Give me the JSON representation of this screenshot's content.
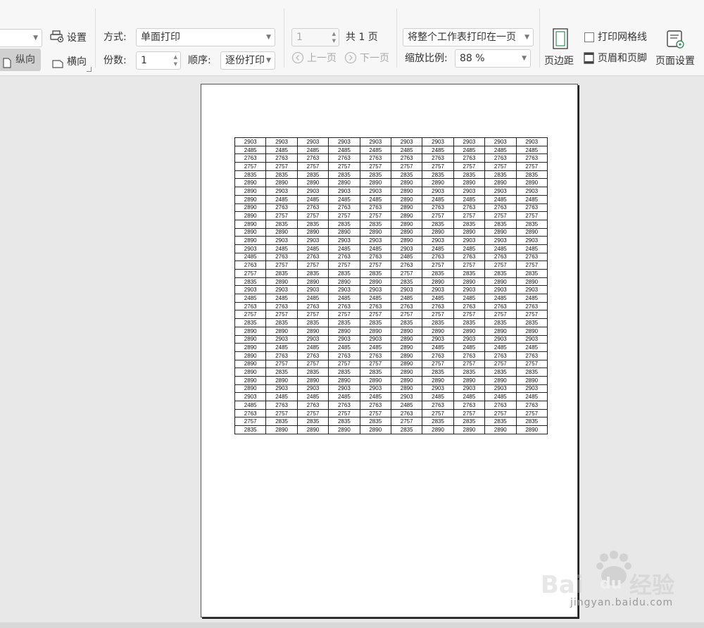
{
  "toolbar": {
    "settings_label": "设置",
    "portrait_label": "纵向",
    "landscape_label": "横向",
    "mode_label": "方式:",
    "mode_value": "单面打印",
    "copies_label": "份数:",
    "copies_value": "1",
    "order_label": "顺序:",
    "order_value": "逐份打印",
    "page_input": "1",
    "total_pages": "共 1 页",
    "prev_page": "上一页",
    "next_page": "下一页",
    "fit_value": "将整个工作表打印在一页",
    "zoom_label": "缩放比例:",
    "zoom_value": "88 %",
    "margins_label": "页边距",
    "gridlines_label": "打印网格线",
    "header_footer_label": "页眉和页脚",
    "page_setup_label": "页面设置"
  },
  "sheet": {
    "rows": [
      [
        "2903",
        "2903",
        "2903",
        "2903",
        "2903",
        "2903",
        "2903",
        "2903",
        "2903",
        "2903"
      ],
      [
        "2485",
        "2485",
        "2485",
        "2485",
        "2485",
        "2485",
        "2485",
        "2485",
        "2485",
        "2485"
      ],
      [
        "2763",
        "2763",
        "2763",
        "2763",
        "2763",
        "2763",
        "2763",
        "2763",
        "2763",
        "2763"
      ],
      [
        "2757",
        "2757",
        "2757",
        "2757",
        "2757",
        "2757",
        "2757",
        "2757",
        "2757",
        "2757"
      ],
      [
        "2835",
        "2835",
        "2835",
        "2835",
        "2835",
        "2835",
        "2835",
        "2835",
        "2835",
        "2835"
      ],
      [
        "2890",
        "2890",
        "2890",
        "2890",
        "2890",
        "2890",
        "2890",
        "2890",
        "2890",
        "2890"
      ],
      [
        "2890",
        "2903",
        "2903",
        "2903",
        "2903",
        "2890",
        "2903",
        "2903",
        "2903",
        "2903"
      ],
      [
        "2890",
        "2485",
        "2485",
        "2485",
        "2485",
        "2890",
        "2485",
        "2485",
        "2485",
        "2485"
      ],
      [
        "2890",
        "2763",
        "2763",
        "2763",
        "2763",
        "2890",
        "2763",
        "2763",
        "2763",
        "2763"
      ],
      [
        "2890",
        "2757",
        "2757",
        "2757",
        "2757",
        "2890",
        "2757",
        "2757",
        "2757",
        "2757"
      ],
      [
        "2890",
        "2835",
        "2835",
        "2835",
        "2835",
        "2890",
        "2835",
        "2835",
        "2835",
        "2835"
      ],
      [
        "2890",
        "2890",
        "2890",
        "2890",
        "2890",
        "2890",
        "2890",
        "2890",
        "2890",
        "2890"
      ],
      [
        "2890",
        "2903",
        "2903",
        "2903",
        "2903",
        "2890",
        "2903",
        "2903",
        "2903",
        "2903"
      ],
      [
        "2903",
        "2485",
        "2485",
        "2485",
        "2485",
        "2903",
        "2485",
        "2485",
        "2485",
        "2485"
      ],
      [
        "2485",
        "2763",
        "2763",
        "2763",
        "2763",
        "2485",
        "2763",
        "2763",
        "2763",
        "2763"
      ],
      [
        "2763",
        "2757",
        "2757",
        "2757",
        "2757",
        "2763",
        "2757",
        "2757",
        "2757",
        "2757"
      ],
      [
        "2757",
        "2835",
        "2835",
        "2835",
        "2835",
        "2757",
        "2835",
        "2835",
        "2835",
        "2835"
      ],
      [
        "2835",
        "2890",
        "2890",
        "2890",
        "2890",
        "2835",
        "2890",
        "2890",
        "2890",
        "2890"
      ],
      [
        "2903",
        "2903",
        "2903",
        "2903",
        "2903",
        "2903",
        "2903",
        "2903",
        "2903",
        "2903"
      ],
      [
        "2485",
        "2485",
        "2485",
        "2485",
        "2485",
        "2485",
        "2485",
        "2485",
        "2485",
        "2485"
      ],
      [
        "2763",
        "2763",
        "2763",
        "2763",
        "2763",
        "2763",
        "2763",
        "2763",
        "2763",
        "2763"
      ],
      [
        "2757",
        "2757",
        "2757",
        "2757",
        "2757",
        "2757",
        "2757",
        "2757",
        "2757",
        "2757"
      ],
      [
        "2835",
        "2835",
        "2835",
        "2835",
        "2835",
        "2835",
        "2835",
        "2835",
        "2835",
        "2835"
      ],
      [
        "2890",
        "2890",
        "2890",
        "2890",
        "2890",
        "2890",
        "2890",
        "2890",
        "2890",
        "2890"
      ],
      [
        "2890",
        "2903",
        "2903",
        "2903",
        "2903",
        "2890",
        "2903",
        "2903",
        "2903",
        "2903"
      ],
      [
        "2890",
        "2485",
        "2485",
        "2485",
        "2485",
        "2890",
        "2485",
        "2485",
        "2485",
        "2485"
      ],
      [
        "2890",
        "2763",
        "2763",
        "2763",
        "2763",
        "2890",
        "2763",
        "2763",
        "2763",
        "2763"
      ],
      [
        "2890",
        "2757",
        "2757",
        "2757",
        "2757",
        "2890",
        "2757",
        "2757",
        "2757",
        "2757"
      ],
      [
        "2890",
        "2835",
        "2835",
        "2835",
        "2835",
        "2890",
        "2835",
        "2835",
        "2835",
        "2835"
      ],
      [
        "2890",
        "2890",
        "2890",
        "2890",
        "2890",
        "2890",
        "2890",
        "2890",
        "2890",
        "2890"
      ],
      [
        "2890",
        "2903",
        "2903",
        "2903",
        "2903",
        "2890",
        "2903",
        "2903",
        "2903",
        "2903"
      ],
      [
        "2903",
        "2485",
        "2485",
        "2485",
        "2485",
        "2903",
        "2485",
        "2485",
        "2485",
        "2485"
      ],
      [
        "2485",
        "2763",
        "2763",
        "2763",
        "2763",
        "2485",
        "2763",
        "2763",
        "2763",
        "2763"
      ],
      [
        "2763",
        "2757",
        "2757",
        "2757",
        "2757",
        "2763",
        "2757",
        "2757",
        "2757",
        "2757"
      ],
      [
        "2757",
        "2835",
        "2835",
        "2835",
        "2835",
        "2757",
        "2835",
        "2835",
        "2835",
        "2835"
      ],
      [
        "2835",
        "2890",
        "2890",
        "2890",
        "2890",
        "2835",
        "2890",
        "2890",
        "2890",
        "2890"
      ]
    ]
  },
  "watermark": {
    "brand": "Bai du 经验",
    "url": "jingyan.baidu.com"
  },
  "colors": {
    "toolbar_bg": "#f7f7f7",
    "workspace_bg": "#e8e8e8",
    "portrait_active_bg": "#d0d0d0",
    "disabled_text": "#aaaaaa"
  }
}
